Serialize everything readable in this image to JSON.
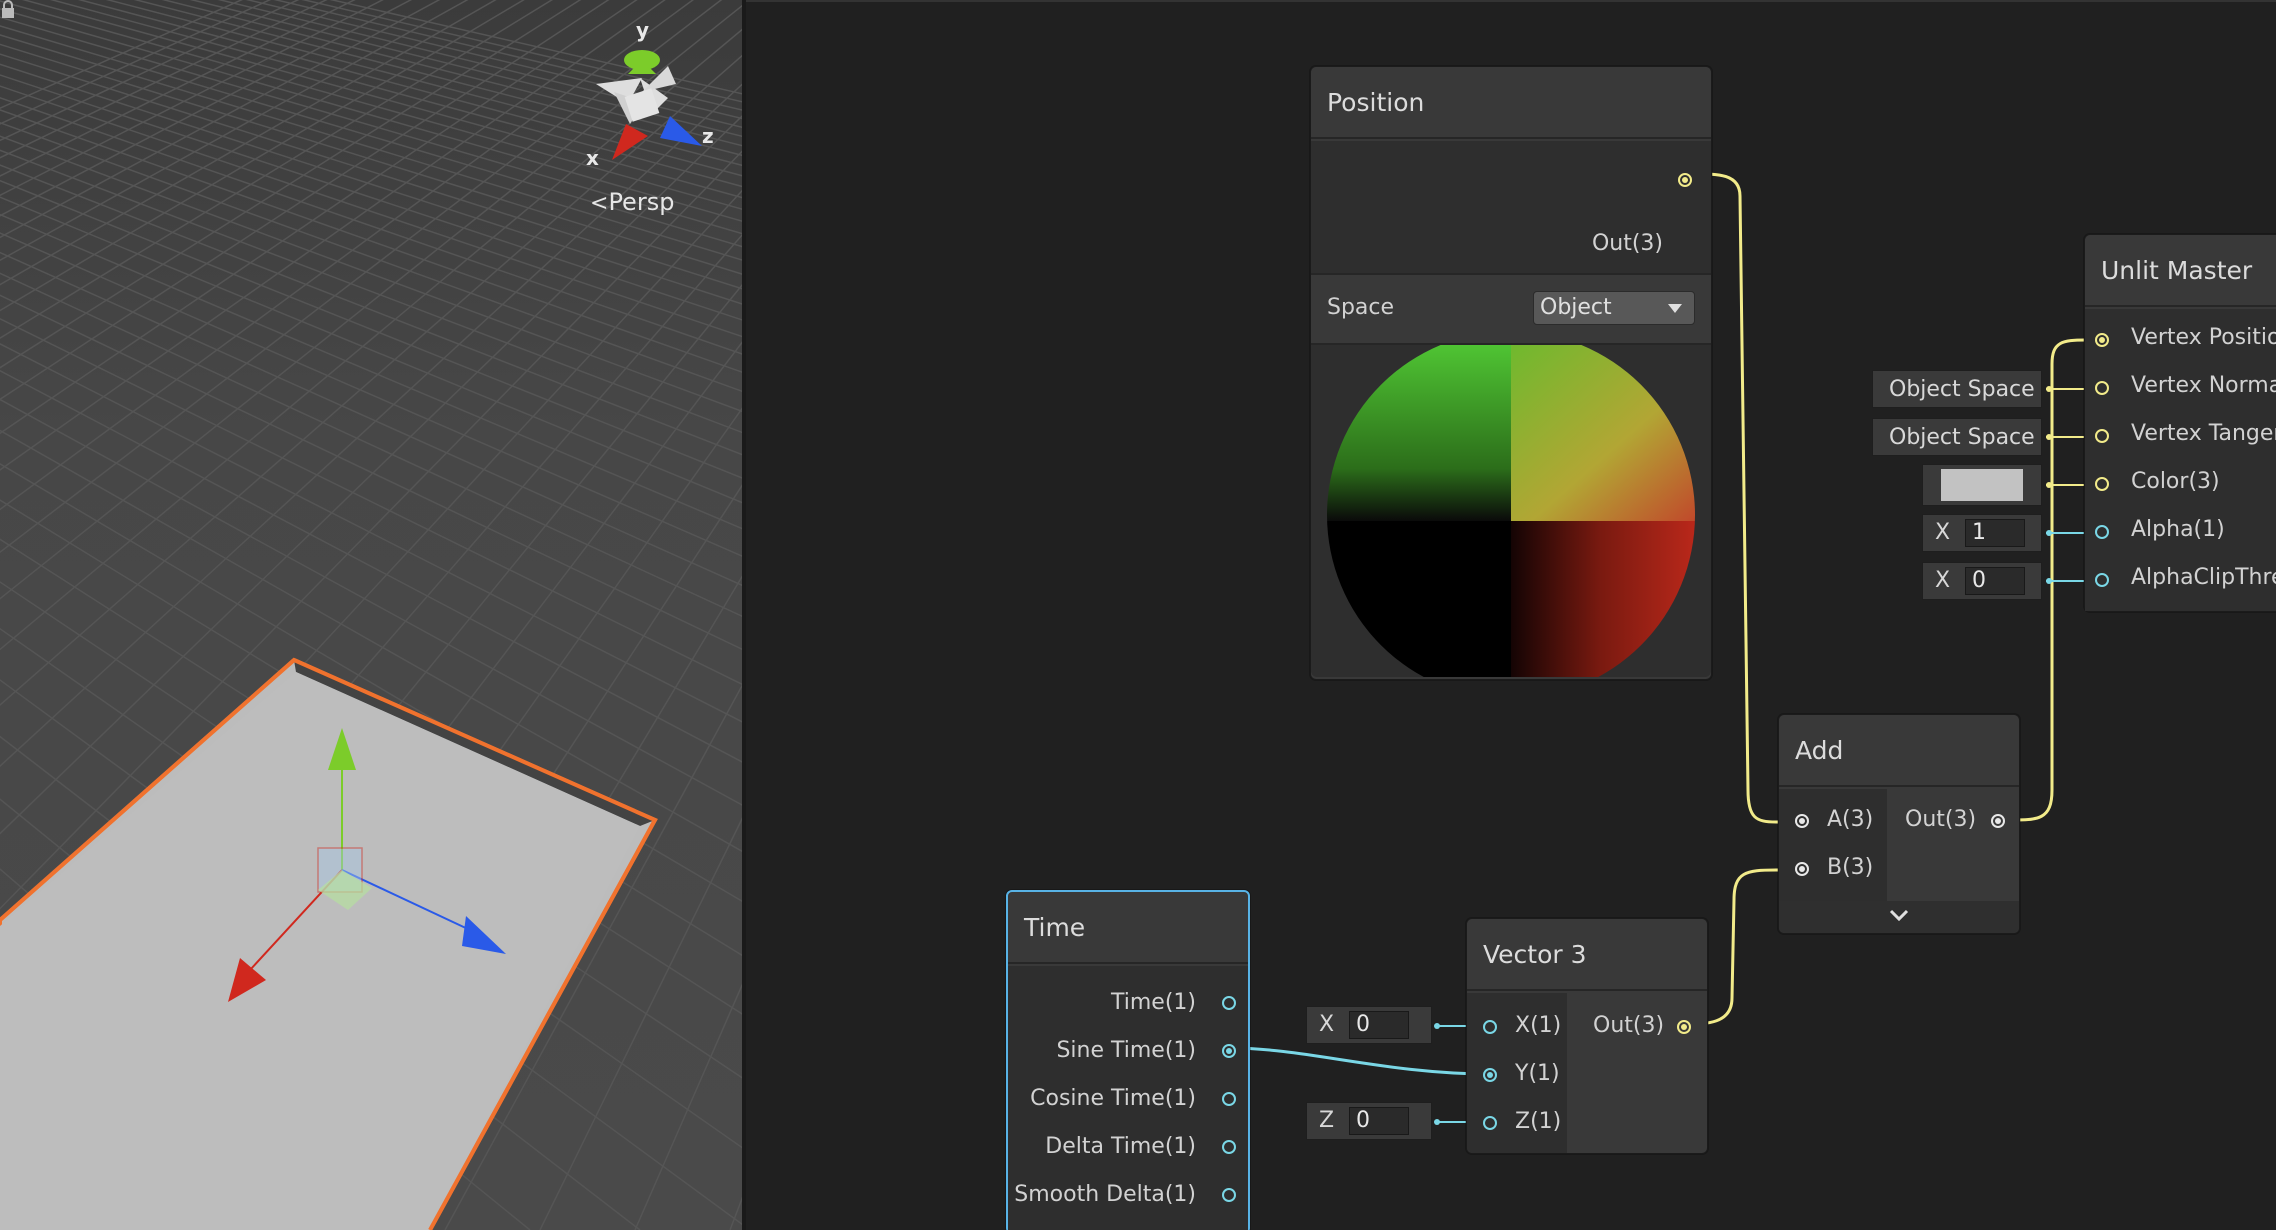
{
  "scene": {
    "gizmo_labels": {
      "y": "y",
      "x": "x",
      "z": "z"
    },
    "projection_label": "Persp",
    "colors": {
      "x_axis": "#d0281e",
      "y_axis": "#7ccc2a",
      "z_axis": "#2a5ae8",
      "selection": "#f0722e"
    }
  },
  "graph": {
    "position_node": {
      "title": "Position",
      "out_port": "Out(3)",
      "space_label": "Space",
      "space_value": "Object"
    },
    "unlit_master": {
      "title": "Unlit Master",
      "ports": [
        "Vertex Positio",
        "Vertex Norma",
        "Vertex Tanger",
        "Color(3)",
        "Alpha(1)",
        "AlphaClipThre"
      ],
      "inputs": {
        "normal_space": "Object Space",
        "tangent_space": "Object Space",
        "alpha_axis": "X",
        "alpha_value": "1",
        "clip_axis": "X",
        "clip_value": "0"
      }
    },
    "add_node": {
      "title": "Add",
      "in_a": "A(3)",
      "in_b": "B(3)",
      "out": "Out(3)"
    },
    "time_node": {
      "title": "Time",
      "ports": [
        "Time(1)",
        "Sine Time(1)",
        "Cosine Time(1)",
        "Delta Time(1)",
        "Smooth Delta(1)"
      ]
    },
    "vector3_node": {
      "title": "Vector 3",
      "in_x": "X(1)",
      "in_y": "Y(1)",
      "in_z": "Z(1)",
      "out": "Out(3)",
      "x_field_axis": "X",
      "x_field_value": "0",
      "z_field_axis": "Z",
      "z_field_value": "0"
    },
    "colors": {
      "vector_wire": "#f2eb8a",
      "float_wire": "#7ad7e6"
    }
  }
}
